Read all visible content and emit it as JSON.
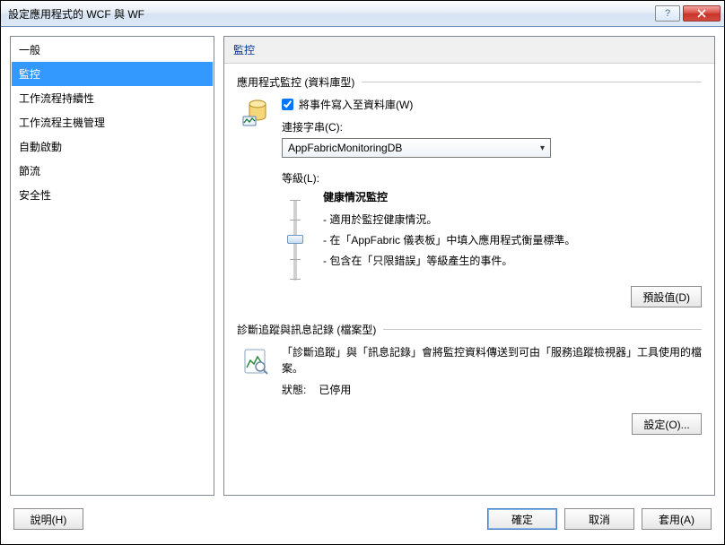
{
  "window": {
    "title": "設定應用程式的 WCF 與 WF"
  },
  "sidebar": {
    "items": [
      {
        "label": "一般"
      },
      {
        "label": "監控"
      },
      {
        "label": "工作流程持續性"
      },
      {
        "label": "工作流程主機管理"
      },
      {
        "label": "自動啟動"
      },
      {
        "label": "節流"
      },
      {
        "label": "安全性"
      }
    ],
    "selected_index": 1
  },
  "pane": {
    "title": "監控",
    "app_monitor": {
      "legend": "應用程式監控 (資料庫型)",
      "checkbox_label": "將事件寫入至資料庫(W)",
      "checkbox_checked": true,
      "conn_label": "連接字串(C):",
      "conn_value": "AppFabricMonitoringDB",
      "level_label": "等級(L):",
      "slider": {
        "title": "健康情況監控",
        "bullets": [
          "- 適用於監控健康情況。",
          "- 在「AppFabric 儀表板」中填入應用程式衡量標準。",
          "- 包含在「只限錯誤」等級產生的事件。"
        ]
      },
      "defaults_button": "預設值(D)"
    },
    "diag": {
      "legend": "診斷追蹤與訊息記錄 (檔案型)",
      "description": "「診斷追蹤」與「訊息記錄」會將監控資料傳送到可由「服務追蹤檢視器」工具使用的檔案。",
      "status_label": "狀態:",
      "status_value": "已停用",
      "settings_button": "設定(O)..."
    }
  },
  "buttons": {
    "help": "說明(H)",
    "ok": "確定",
    "cancel": "取消",
    "apply": "套用(A)"
  }
}
